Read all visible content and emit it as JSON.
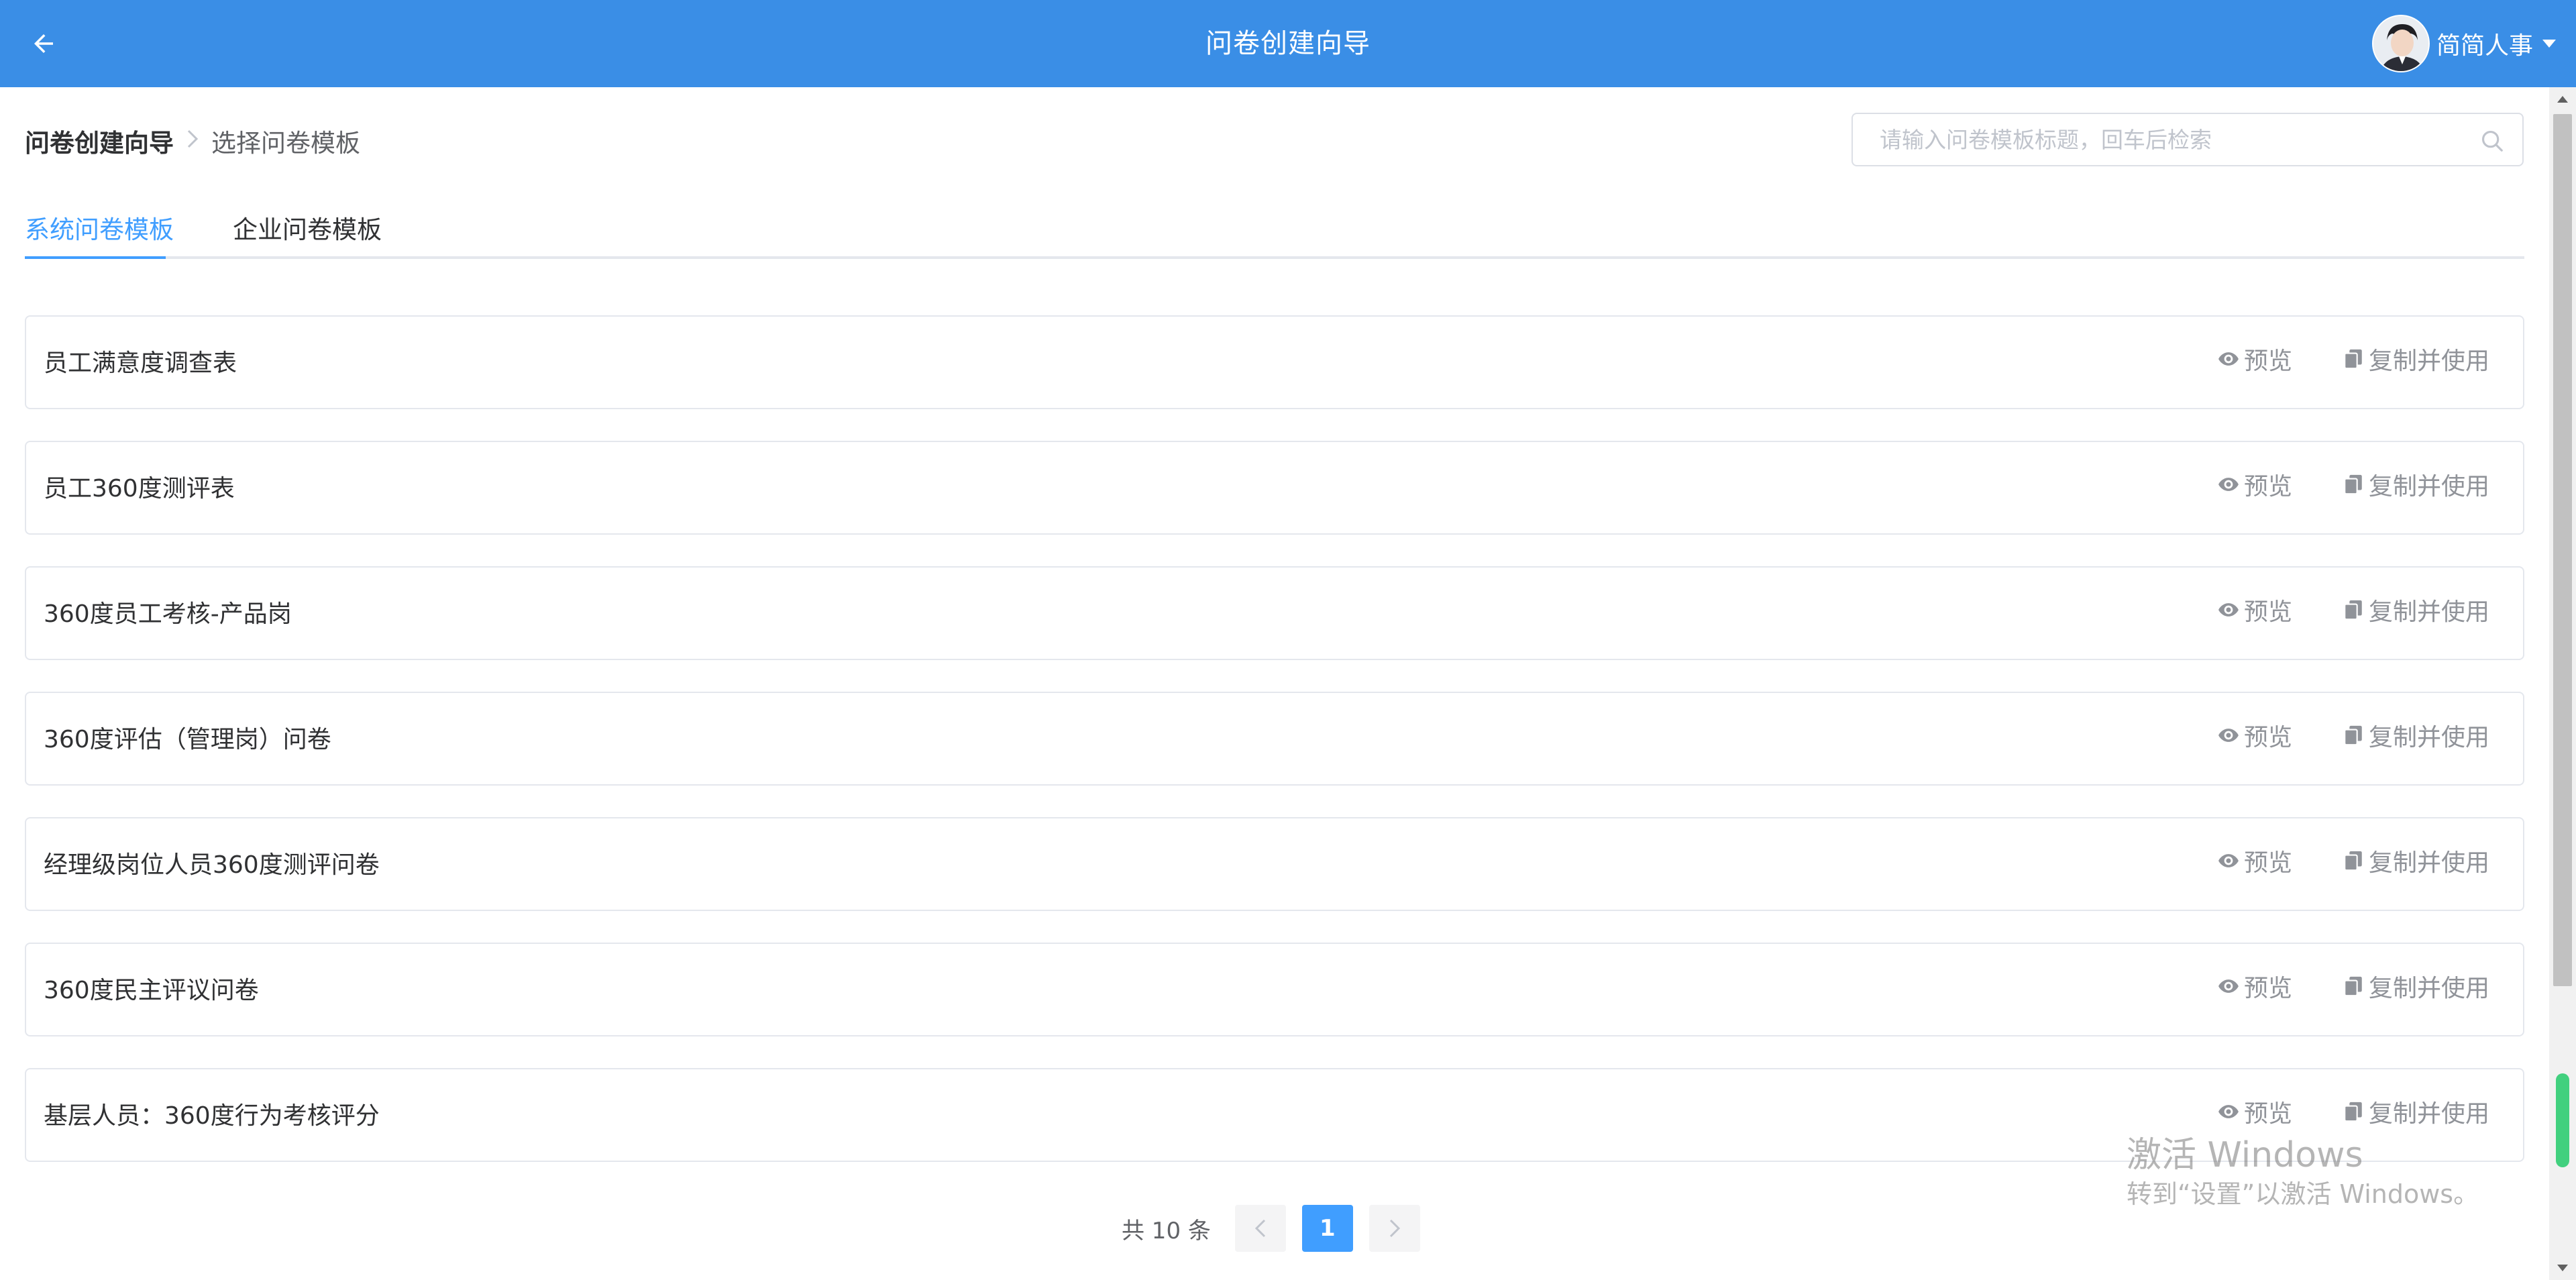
{
  "header": {
    "title": "问卷创建向导",
    "user_name": "简简人事"
  },
  "breadcrumb": {
    "root": "问卷创建向导",
    "separator": ">",
    "current": "选择问卷模板"
  },
  "search": {
    "placeholder": "请输入问卷模板标题，回车后检索",
    "value": ""
  },
  "tabs": [
    {
      "label": "系统问卷模板",
      "active": true
    },
    {
      "label": "企业问卷模板",
      "active": false
    }
  ],
  "actions": {
    "preview": "预览",
    "copy_use": "复制并使用"
  },
  "templates": [
    {
      "title": "员工满意度调查表"
    },
    {
      "title": "员工360度测评表"
    },
    {
      "title": "360度员工考核-产品岗"
    },
    {
      "title": "360度评估（管理岗）问卷"
    },
    {
      "title": "经理级岗位人员360度测评问卷"
    },
    {
      "title": "360度民主评议问卷"
    },
    {
      "title": "基层人员：360度行为考核评分"
    }
  ],
  "pagination": {
    "total_text": "共 10 条",
    "current_page": "1"
  },
  "watermark": {
    "title": "激活 Windows",
    "subtitle": "转到“设置”以激活 Windows。"
  },
  "colors": {
    "header_bg": "#3a8ee6",
    "accent": "#409eff",
    "border": "#e4e7ed",
    "muted_text": "#909399"
  },
  "icons": {
    "back": "arrow-left-icon",
    "search": "search-icon",
    "preview": "eye-icon",
    "copy": "copy-icon",
    "caret": "caret-down-icon"
  }
}
